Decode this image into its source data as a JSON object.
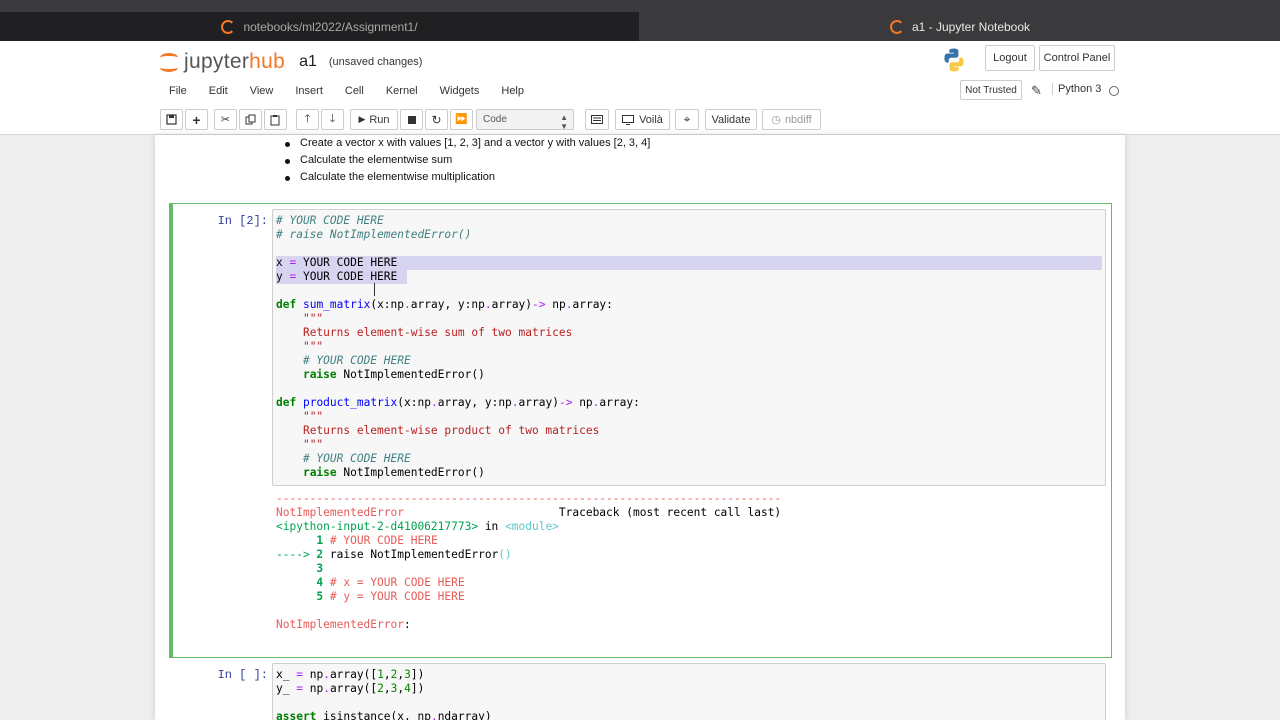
{
  "browser": {
    "tab_left_title": "notebooks/ml2022/Assignment1/",
    "tab_right_title": "a1 - Jupyter Notebook"
  },
  "header": {
    "logo_jupyter": "jupyter",
    "logo_hub": "hub",
    "notebook_name": "a1",
    "save_status": "(unsaved changes)",
    "logout_label": "Logout",
    "control_panel_label": "Control Panel"
  },
  "menubar": {
    "items": [
      "File",
      "Edit",
      "View",
      "Insert",
      "Cell",
      "Kernel",
      "Widgets",
      "Help"
    ],
    "not_trusted_label": "Not Trusted",
    "kernel_name": "Python 3"
  },
  "toolbar": {
    "run_label": "Run",
    "cell_type": "Code",
    "voila_label": "Voilà",
    "validate_label": "Validate",
    "nbdiff_label": "nbdiff"
  },
  "markdown_cell": {
    "bullets": [
      "Create a vector x with values [1, 2, 3] and a vector y with values [2, 3, 4]",
      "Calculate the elementwise sum",
      "Calculate the elementwise multiplication"
    ]
  },
  "code_cell_1": {
    "prompt": "In [2]:"
  },
  "code_cell_2": {
    "prompt": "In [ ]:"
  },
  "colors": {
    "accent_orange": "#f37726",
    "selected_cell_border": "#66bb6a",
    "prompt_blue": "#303f9f",
    "error_red": "#e75c58"
  }
}
